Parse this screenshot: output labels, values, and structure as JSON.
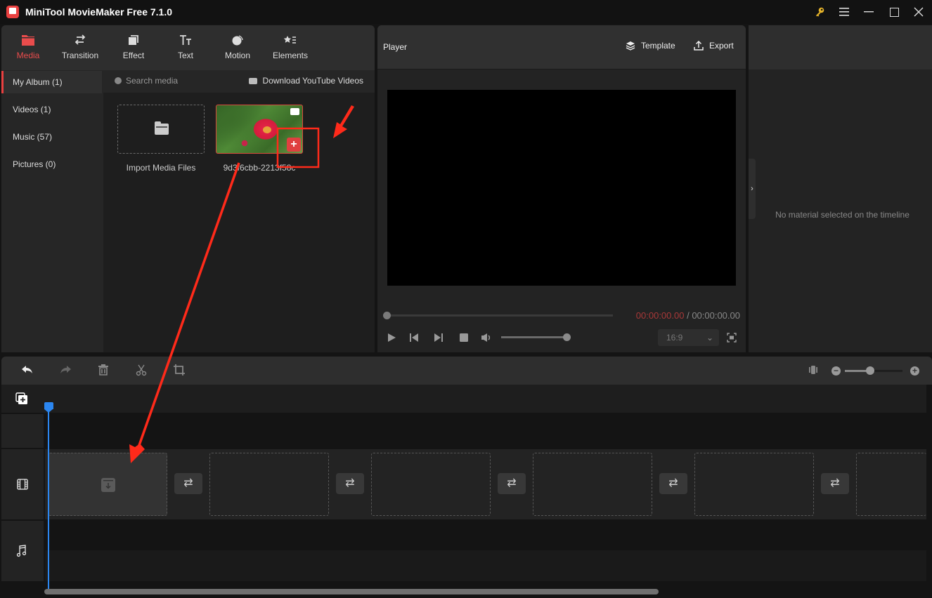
{
  "app": {
    "title": "MiniTool MovieMaker Free 7.1.0",
    "window_controls": [
      "key-icon",
      "menu-icon",
      "minimize-icon",
      "maximize-icon",
      "close-icon"
    ],
    "accent_color": "#e94c4c"
  },
  "top_tabs": [
    {
      "label": "Media",
      "icon": "folder-icon",
      "active": true
    },
    {
      "label": "Transition",
      "icon": "swap-arrows-icon",
      "active": false
    },
    {
      "label": "Effect",
      "icon": "stacked-squares-icon",
      "active": false
    },
    {
      "label": "Text",
      "icon": "text-tt-icon",
      "active": false
    },
    {
      "label": "Motion",
      "icon": "motion-sphere-icon",
      "active": false
    },
    {
      "label": "Elements",
      "icon": "star-list-icon",
      "active": false
    }
  ],
  "sidebar": {
    "items": [
      {
        "label": "My Album (1)",
        "active": true
      },
      {
        "label": "Videos (1)",
        "active": false
      },
      {
        "label": "Music (57)",
        "active": false
      },
      {
        "label": "Pictures (0)",
        "active": false
      }
    ]
  },
  "media": {
    "search_placeholder": "Search media",
    "download_label": "Download YouTube Videos",
    "import_label": "Import Media Files",
    "items": [
      {
        "name": "9d3f6cbb-2213f58c",
        "type": "video",
        "add_label": "+"
      }
    ]
  },
  "player": {
    "title": "Player",
    "template_label": "Template",
    "export_label": "Export",
    "current_time": "00:00:00.00",
    "separator": " / ",
    "total_time": "00:00:00.00",
    "progress": 0,
    "volume": 1.0,
    "aspect_ratio": "16:9"
  },
  "properties": {
    "empty_message": "No material selected on the timeline"
  },
  "timeline": {
    "toolbar": [
      "undo-icon",
      "redo-icon",
      "delete-icon",
      "cut-icon",
      "crop-icon"
    ],
    "zoom_level": 0.4,
    "video_slots": 6,
    "transition_buttons": 5,
    "playhead_color": "#2b86f0"
  },
  "annotations": {
    "color": "#ff2a1a",
    "description": "Red box around add (+) button on media thumbnail with arrows pointing to it and to the first timeline slot"
  }
}
